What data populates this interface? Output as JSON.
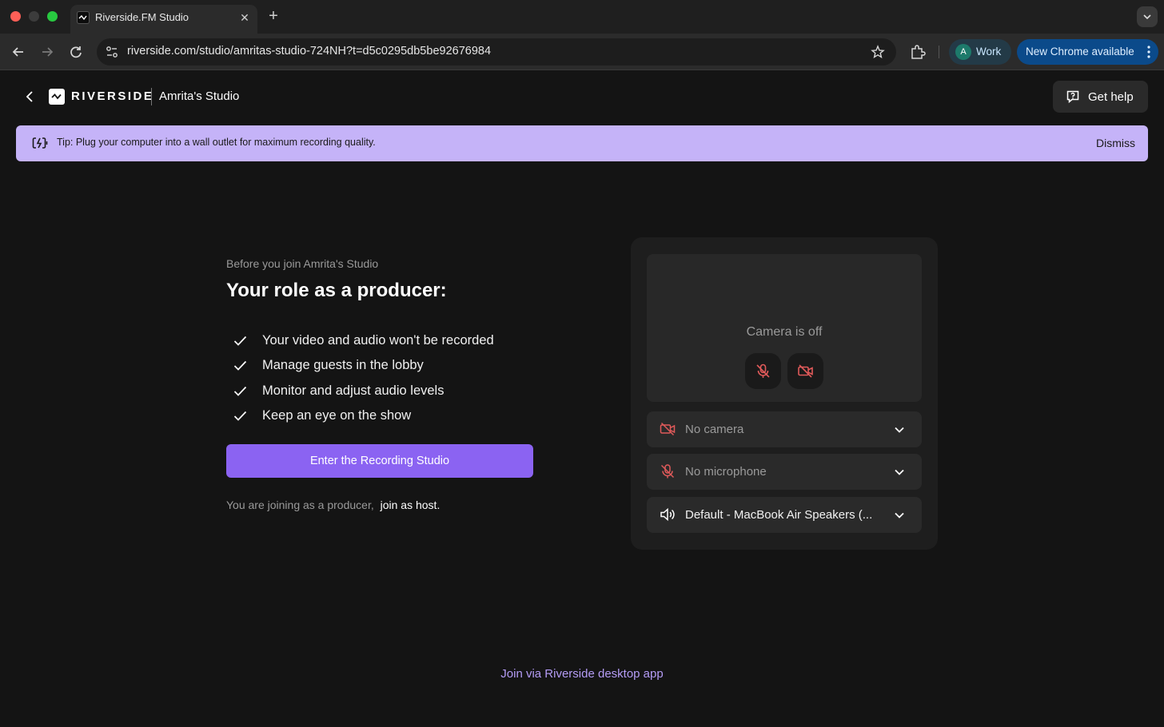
{
  "browser": {
    "tab_title": "Riverside.FM Studio",
    "tab_close": "✕",
    "new_tab": "+",
    "url": "riverside.com/studio/amritas-studio-724NH?t=d5c0295db5be92676984",
    "profile_initial": "A",
    "profile_label": "Work",
    "update_label": "New Chrome available"
  },
  "header": {
    "brand": "RIVERSIDE",
    "studio_name": "Amrita's Studio",
    "help_label": "Get help"
  },
  "tip": {
    "text": "Tip: Plug your computer into a wall outlet for maximum recording quality.",
    "dismiss": "Dismiss"
  },
  "intro": {
    "pre_title": "Before you join Amrita's Studio",
    "title": "Your role as a producer:",
    "items": [
      "Your video and audio won't be recorded",
      "Manage guests in the lobby",
      "Monitor and adjust audio levels",
      "Keep an eye on the show"
    ],
    "enter_button": "Enter the Recording Studio",
    "joining_text": "You are joining as a producer,",
    "join_host": "join as host."
  },
  "devices": {
    "camera_status": "Camera is off",
    "camera_select": "No camera",
    "mic_select": "No microphone",
    "speaker_select": "Default - MacBook Air Speakers (..."
  },
  "footer": {
    "desktop_link": "Join via Riverside desktop app"
  },
  "colors": {
    "accent": "#8b63f2",
    "tip_bg": "#c5b3f8",
    "muted_red": "#e05a5a"
  }
}
